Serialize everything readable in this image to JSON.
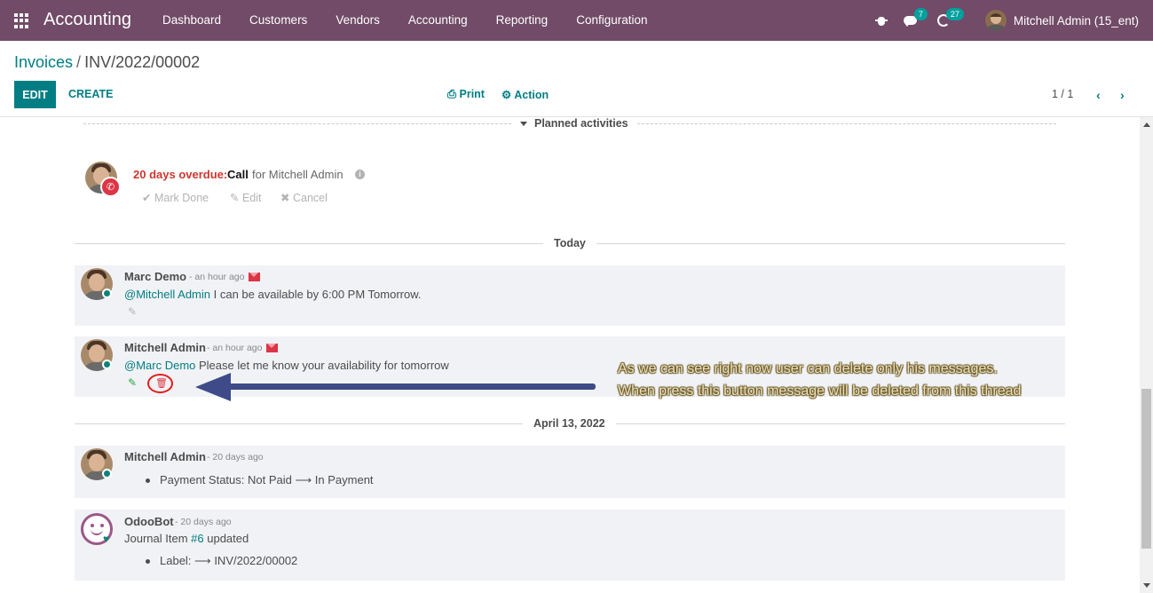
{
  "navbar": {
    "app_title": "Accounting",
    "menu": [
      "Dashboard",
      "Customers",
      "Vendors",
      "Accounting",
      "Reporting",
      "Configuration"
    ],
    "messages_count": "7",
    "activities_count": "27",
    "user_name": "Mitchell Admin (15_ent)",
    "bar_color": "#714b67"
  },
  "control_panel": {
    "breadcrumb_parent": "Invoices",
    "breadcrumb_separator": "/",
    "breadcrumb_current": "INV/2022/00002",
    "edit_label": "EDIT",
    "create_label": "CREATE",
    "print_label": "Print",
    "action_label": "Action",
    "pager": "1 / 1",
    "accent_color": "#017e84"
  },
  "planned": {
    "title": "Planned activities",
    "activity": {
      "overdue": "20 days overdue:",
      "type": "Call",
      "assignee": "for Mitchell Admin",
      "mark_done": "Mark Done",
      "edit": "Edit",
      "cancel": "Cancel"
    }
  },
  "thread": {
    "sep_today": "Today",
    "sep_april": "April 13, 2022",
    "messages": [
      {
        "author": "Marc Demo",
        "date": "- an hour ago",
        "mention": "@Mitchell Admin",
        "text": " I can be available by 6:00 PM Tomorrow."
      },
      {
        "author": "Mitchell Admin",
        "date": "- an hour ago",
        "mention": "@Marc Demo",
        "text": " Please let me know your availability for tomorrow"
      },
      {
        "author": "Mitchell Admin",
        "date": "- 20 days ago",
        "tracking_field": "Payment Status:",
        "tracking_old": "Not Paid",
        "tracking_arrow": "⟶",
        "tracking_new": "In Payment"
      },
      {
        "author": "OdooBot",
        "date": "- 20 days ago",
        "text_before": "Journal Item ",
        "link": "#6",
        "text_after": " updated",
        "tracking_field": "Label:",
        "tracking_arrow": "⟶",
        "tracking_new": "INV/2022/00002"
      }
    ]
  },
  "annotation": {
    "line1": "As we can see right now user can delete only his messages.",
    "line2": "When press this button message will be deleted from this thread",
    "arrow_color": "#3e4b88",
    "highlight_color": "#e31c1c"
  }
}
